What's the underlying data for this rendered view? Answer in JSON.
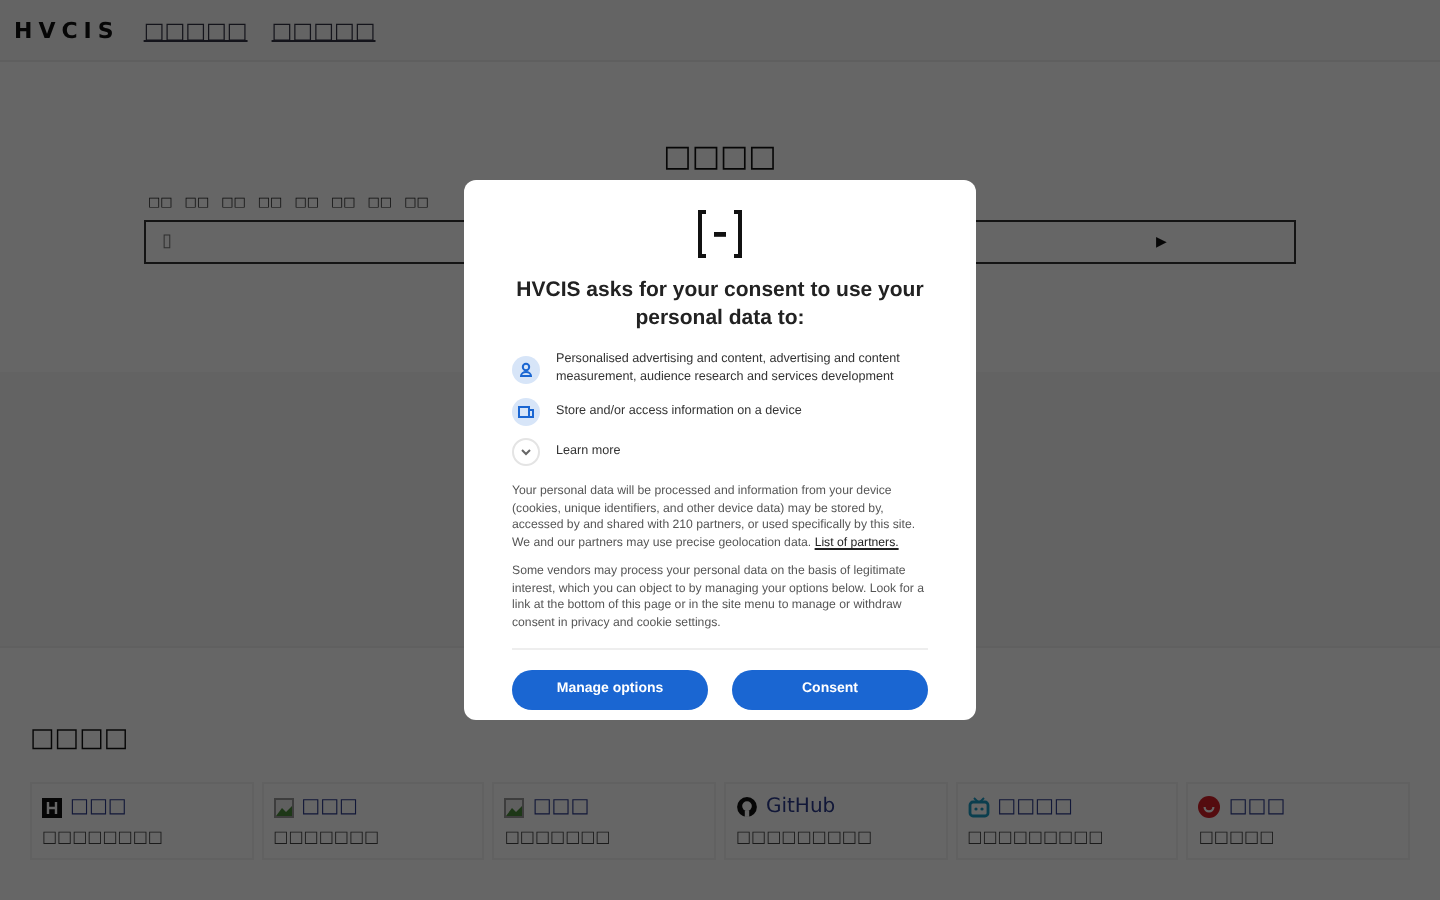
{
  "nav": {
    "brand": "HVCIS",
    "links": [
      "□□□□□",
      "□□□□□"
    ]
  },
  "hero": {
    "title": "□□□□",
    "tabs": [
      "□□",
      "□□",
      "□□",
      "□□",
      "□□",
      "□□",
      "□□",
      "□□"
    ],
    "search": {
      "placeholder": "▯",
      "submit": "▶"
    }
  },
  "section": {
    "title": "□□□□",
    "cards": [
      {
        "kind": "letter",
        "name": "□□□",
        "desc": "□□□□□□□□"
      },
      {
        "kind": "image",
        "name": "□□□",
        "desc": "□□□□□□□"
      },
      {
        "kind": "image",
        "name": "□□□",
        "desc": "□□□□□□□"
      },
      {
        "kind": "github",
        "name": "GitHub",
        "desc": "□□□□□□□□□"
      },
      {
        "kind": "tv",
        "name": "□□□□",
        "desc": "□□□□□□□□□"
      },
      {
        "kind": "circle",
        "name": "□□□",
        "desc": "□□□□□"
      }
    ]
  },
  "consent": {
    "title": "HVCIS asks for your consent to use your personal data to:",
    "purposes": [
      {
        "kind": "person",
        "text": "Personalised advertising and content, advertising and content measurement, audience research and services development"
      },
      {
        "kind": "device",
        "text": "Store and/or access information on a device"
      },
      {
        "kind": "chevron",
        "text": "Learn more"
      }
    ],
    "paragraphs": [
      "Your personal data will be processed and information from your device (cookies, unique identifiers, and other device data) may be stored by, accessed by and shared with 210 partners, or used specifically by this site. We and our partners may use precise geolocation data.",
      "Some vendors may process your personal data on the basis of legitimate interest, which you can object to by managing your options below. Look for a link at the bottom of this page or in the site menu to manage or withdraw consent in privacy and cookie settings."
    ],
    "partners_link": "List of partners.",
    "buttons": [
      "Manage options",
      "Consent"
    ]
  }
}
